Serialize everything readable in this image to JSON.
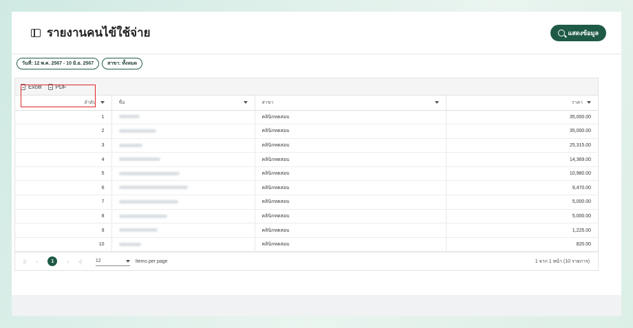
{
  "header": {
    "title": "รายงานคนไข้ใช้จ่าย",
    "show_button_label": "แสดงข้อมูล"
  },
  "filters": {
    "date_range": "วันที่: 12 พ.ค. 2567 - 10 มิ.ย. 2567",
    "branch": "สาขา: ทั้งหมด"
  },
  "toolbar": {
    "excel_label": "Excel",
    "pdf_label": "PDF"
  },
  "table": {
    "columns": {
      "index": "ลำดับ",
      "name": "ชื่อ",
      "branch": "สาขา",
      "price": "ราคา"
    },
    "rows": [
      {
        "index": "1",
        "branch": "คลินิกทดสอบ",
        "price": "35,000.00"
      },
      {
        "index": "2",
        "branch": "คลินิกทดสอบ",
        "price": "35,000.00"
      },
      {
        "index": "3",
        "branch": "คลินิกทดสอบ",
        "price": "25,315.00"
      },
      {
        "index": "4",
        "branch": "คลินิกทดสอบ",
        "price": "14,369.00"
      },
      {
        "index": "5",
        "branch": "คลินิกทดสอบ",
        "price": "10,980.00"
      },
      {
        "index": "6",
        "branch": "คลินิกทดสอบ",
        "price": "9,470.00"
      },
      {
        "index": "7",
        "branch": "คลินิกทดสอบ",
        "price": "5,000.00"
      },
      {
        "index": "8",
        "branch": "คลินิกทดสอบ",
        "price": "5,000.00"
      },
      {
        "index": "9",
        "branch": "คลินิกทดสอบ",
        "price": "1,225.00"
      },
      {
        "index": "10",
        "branch": "คลินิกทดสอบ",
        "price": "820.00"
      }
    ]
  },
  "pager": {
    "current_page": "1",
    "page_size": "12",
    "items_per_page_label": "Items per page",
    "info": "1 จาก 1 หน้า (10 รายการ)"
  },
  "colors": {
    "accent": "#1f5a47",
    "highlight": "#e02020"
  }
}
